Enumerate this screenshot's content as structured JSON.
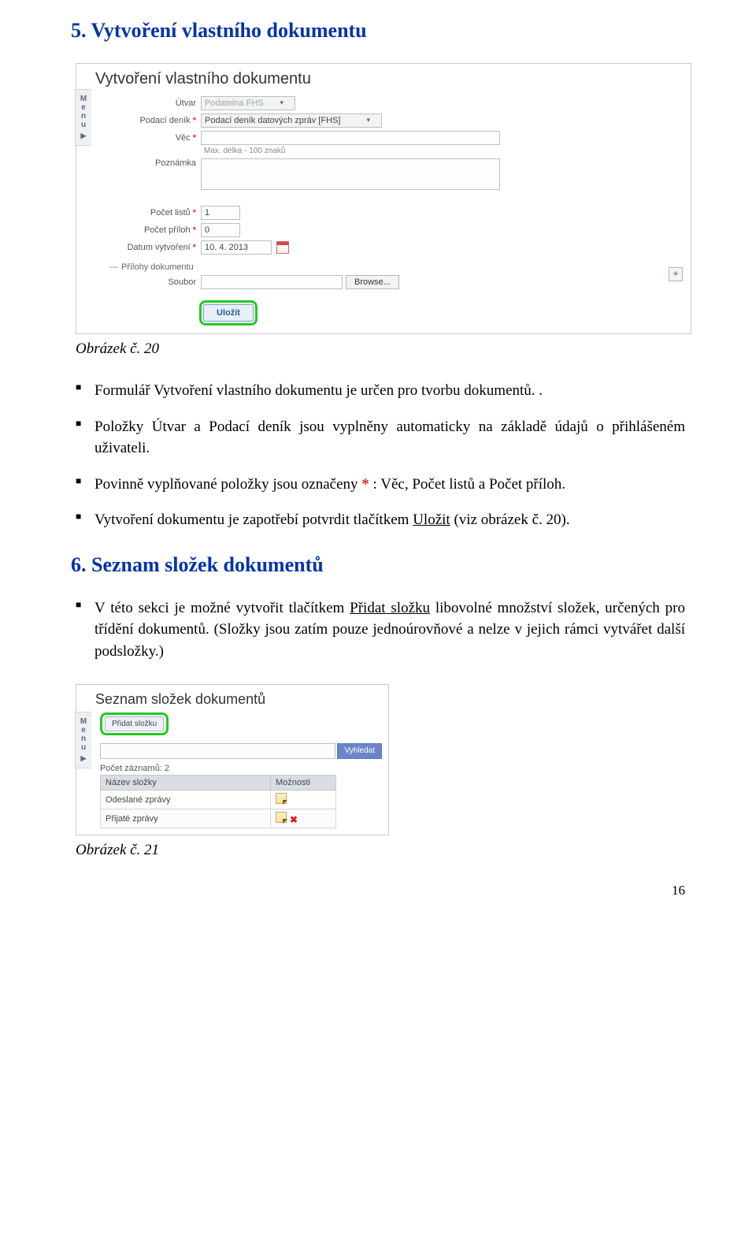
{
  "section5": {
    "heading": "5. Vytvoření vlastního dokumentu"
  },
  "shot1": {
    "title": "Vytvoření vlastního dokumentu",
    "menu": "Menu",
    "labels": {
      "utvar": "Útvar",
      "podaci": "Podací deník",
      "vec": "Věc",
      "poznamka": "Poznámka",
      "listu": "Počet listů",
      "priloh": "Počet příloh",
      "datum": "Datum vytvoření",
      "soubor": "Soubor"
    },
    "values": {
      "utvar": "Podatelna FHS",
      "podaci": "Podací deník datových zpráv [FHS]",
      "listu": "1",
      "priloh": "0",
      "datum": "10. 4. 2013"
    },
    "maxlen_hint": "Max. délka - 100 znaků",
    "attach_header": "Přílohy dokumentu",
    "browse": "Browse...",
    "save": "Uložit"
  },
  "caption1": "Obrázek č. 20",
  "bullets1": {
    "b1": "Formulář Vytvoření vlastního dokumentu je určen pro tvorbu dokumentů. .",
    "b2": "Položky Útvar a Podací deník jsou vyplněny automaticky na základě údajů o přihlášeném uživateli.",
    "b3_a": "Povinně vyplňované položky jsou označeny ",
    "b3_star": "*",
    "b3_b": " : Věc, Počet listů a Počet příloh.",
    "b4_a": "Vytvoření dokumentu je zapotřebí potvrdit tlačítkem ",
    "b4_u": "Uložit",
    "b4_b": " (viz obrázek č. 20)."
  },
  "section6": {
    "heading": "6. Seznam složek dokumentů",
    "bullet_a": "V této sekci je možné vytvořit tlačítkem ",
    "bullet_u": "Přidat složku",
    "bullet_b": " libovolné množství složek, určených pro třídění dokumentů. (Složky jsou zatím pouze jednoúrovňové a nelze v jejich rámci vytvářet další podsložky.)"
  },
  "shot2": {
    "title": "Seznam složek dokumentů",
    "menu": "Menu",
    "add": "Přidat složku",
    "search": "Vyhledat",
    "count": "Počet záznamů: 2",
    "th1": "Název složky",
    "th2": "Možnosti",
    "row1": "Odeslané zprávy",
    "row2": "Přijaté zprávy"
  },
  "caption2": "Obrázek č. 21",
  "page_number": "16"
}
